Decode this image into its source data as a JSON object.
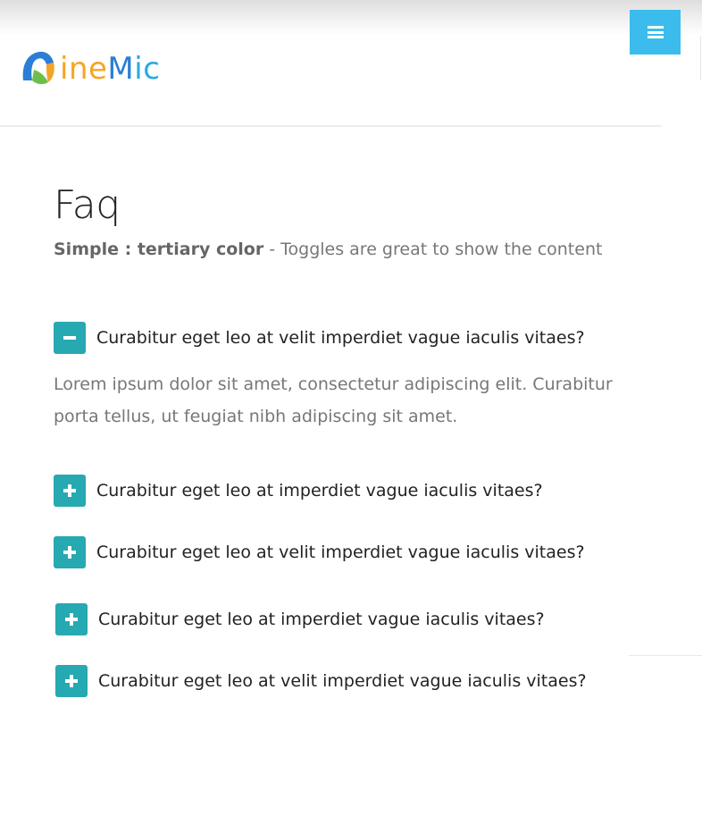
{
  "header": {
    "logo_text": {
      "n": "N",
      "ine": "ine",
      "m": "M",
      "ic": "ic"
    },
    "menu_icon": "hamburger-icon",
    "accent_color": "#3bbcec"
  },
  "page": {
    "title": "Faq",
    "subtitle_bold": "Simple : tertiary color",
    "subtitle_rest": " - Toggles are great to show the content"
  },
  "faq": {
    "toggle_color": "#26a9b1",
    "items": [
      {
        "question": "Curabitur eget leo at velit imperdiet vague iaculis vitaes?",
        "expanded": true,
        "icon": "minus-icon",
        "answer": "Lorem ipsum dolor sit amet, consectetur adipiscing elit. Curabitur porta tellus, ut feugiat nibh adipiscing sit amet."
      },
      {
        "question": "Curabitur eget leo at imperdiet vague iaculis vitaes?",
        "expanded": false,
        "icon": "plus-icon"
      },
      {
        "question": "Curabitur eget leo at velit imperdiet vague iaculis vitaes?",
        "expanded": false,
        "icon": "plus-icon"
      },
      {
        "question": "Curabitur eget leo at imperdiet vague iaculis vitaes?",
        "expanded": false,
        "icon": "plus-icon"
      },
      {
        "question": "Curabitur eget leo at velit imperdiet vague iaculis vitaes?",
        "expanded": false,
        "icon": "plus-icon"
      }
    ]
  }
}
